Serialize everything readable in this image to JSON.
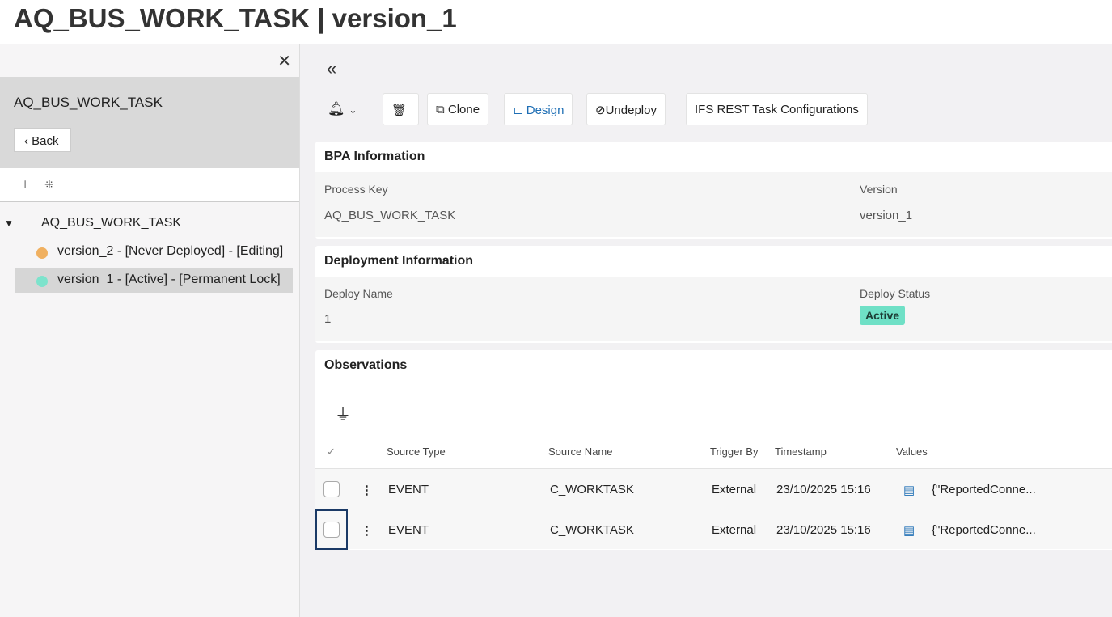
{
  "title": "AQ_BUS_WORK_TASK | version_1",
  "left": {
    "name": "AQ_BUS_WORK_TASK",
    "back": "Back",
    "tree_root": "AQ_BUS_WORK_TASK",
    "items": [
      {
        "label": "version_2 - [Never Deployed] - [Editing]",
        "color": "#f0b060"
      },
      {
        "label": "version_1 - [Active] - [Permanent Lock]",
        "color": "#7de3cc"
      }
    ]
  },
  "toolbar": {
    "clone": "Clone",
    "design": "Design",
    "undeploy": "Undeploy",
    "ifs": "IFS REST Task Configurations"
  },
  "bpa": {
    "title": "BPA Information",
    "process_key_label": "Process Key",
    "process_key": "AQ_BUS_WORK_TASK",
    "version_label": "Version",
    "version": "version_1"
  },
  "deploy": {
    "title": "Deployment Information",
    "name_label": "Deploy Name",
    "name": "1",
    "status_label": "Deploy Status",
    "status": "Active"
  },
  "obs": {
    "title": "Observations",
    "columns": [
      "Source Type",
      "Source Name",
      "Trigger By",
      "Timestamp",
      "Values"
    ],
    "rows": [
      [
        "EVENT",
        "C_WORKTASK",
        "External",
        "23/10/2025 15:16",
        "{\"ReportedConne..."
      ],
      [
        "EVENT",
        "C_WORKTASK",
        "External",
        "23/10/2025 15:16",
        "{\"ReportedConne..."
      ]
    ]
  }
}
